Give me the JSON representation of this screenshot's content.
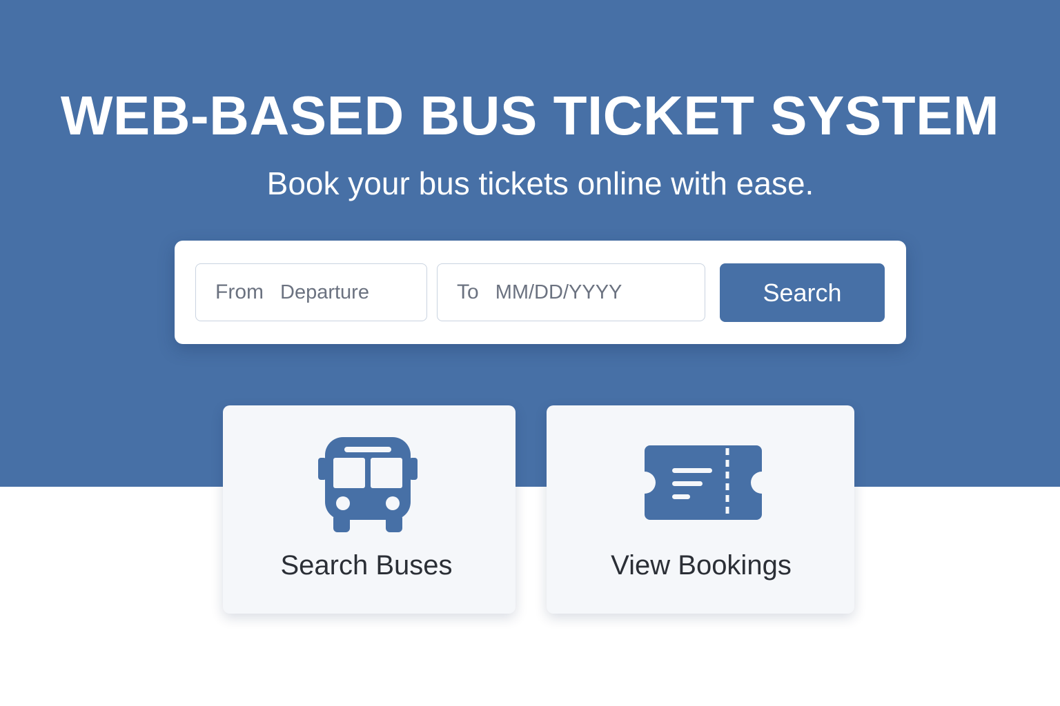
{
  "colors": {
    "primary": "#4770a6",
    "card_background": "#f5f7fa",
    "white": "#ffffff",
    "label_gray": "#6b7280"
  },
  "hero": {
    "title": "WEB-BASED BUS TICKET SYSTEM",
    "subtitle": "Book your bus tickets online with ease."
  },
  "search_form": {
    "from_label": "From",
    "from_placeholder": "Departure",
    "from_value": "",
    "to_label": "To",
    "to_placeholder": "MM/DD/YYYY",
    "to_value": "",
    "button_label": "Search"
  },
  "feature_cards": [
    {
      "label": "Search Buses",
      "icon": "bus-icon"
    },
    {
      "label": "View Bookings",
      "icon": "ticket-icon"
    }
  ]
}
